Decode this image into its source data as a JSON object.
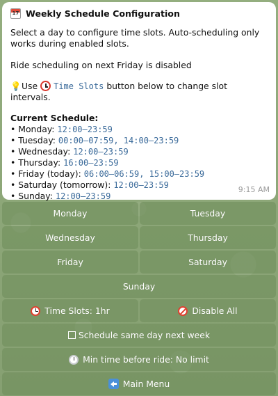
{
  "message": {
    "title": "Weekly Schedule Configuration",
    "calendar_day": "17",
    "intro": "Select a day to configure time slots. Auto-scheduling only works during enabled slots.",
    "status": "Ride scheduling on next Friday is disabled",
    "hint_prefix": "Use",
    "hint_code": "Time Slots",
    "hint_suffix": "button below to change slot intervals.",
    "schedule_heading": "Current Schedule:",
    "schedule": [
      {
        "day": "• Monday:",
        "slots": "12:00–23:59"
      },
      {
        "day": "• Tuesday:",
        "slots": "00:00–07:59, 14:00–23:59"
      },
      {
        "day": "• Wednesday:",
        "slots": "12:00–23:59"
      },
      {
        "day": "• Thursday:",
        "slots": "16:00–23:59"
      },
      {
        "day": "• Friday (today):",
        "slots": "06:00–06:59, 15:00–23:59"
      },
      {
        "day": "• Saturday (tomorrow):",
        "slots": "12:00–23:59"
      },
      {
        "day": "• Sunday:",
        "slots": "12:00–23:59"
      }
    ],
    "time": "9:15 AM"
  },
  "keyboard": {
    "monday": "Monday",
    "tuesday": "Tuesday",
    "wednesday": "Wednesday",
    "thursday": "Thursday",
    "friday": "Friday",
    "saturday": "Saturday",
    "sunday": "Sunday",
    "time_slots": "Time Slots: 1hr",
    "disable_all": "Disable All",
    "same_day": "Schedule same day next week",
    "min_time": "Min time before ride: No limit",
    "main_menu": "Main Menu"
  },
  "icons": {
    "title": "calendar-icon",
    "hint": "light-bulb-icon",
    "time_slots": "alarm-clock-icon",
    "disable_all": "no-entry-icon",
    "same_day": "checkbox-icon",
    "min_time": "timer-icon",
    "main_menu": "back-arrow-icon"
  }
}
